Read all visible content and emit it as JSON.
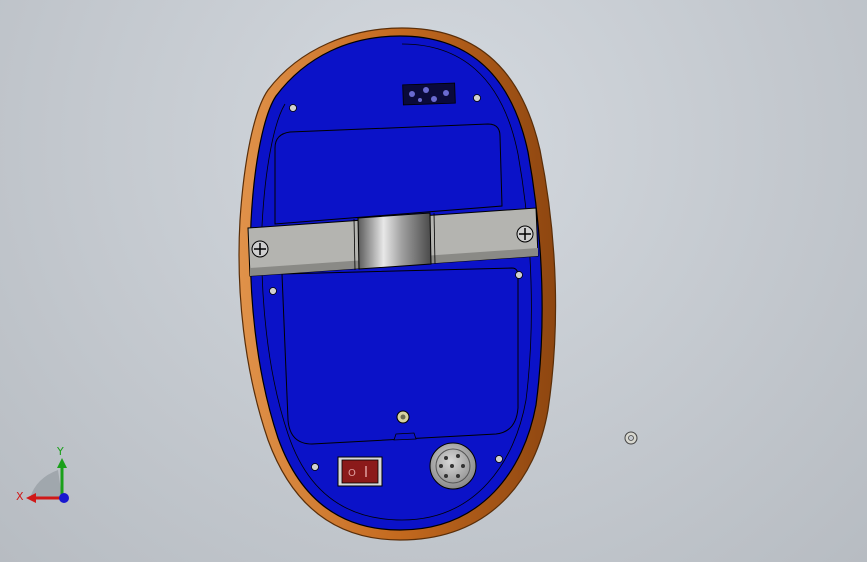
{
  "view": {
    "background_color": "#c5cad0"
  },
  "model": {
    "housing_color": "#c46a1f",
    "shell_color": "#0b12c8",
    "bracket_color": "#b4b4b0",
    "switch_color": "#8b1a1a"
  },
  "triad": {
    "y_label": "Y",
    "x_label": "X",
    "y_color": "#1aa01a",
    "x_color": "#d01818",
    "z_color": "#1818d0"
  }
}
